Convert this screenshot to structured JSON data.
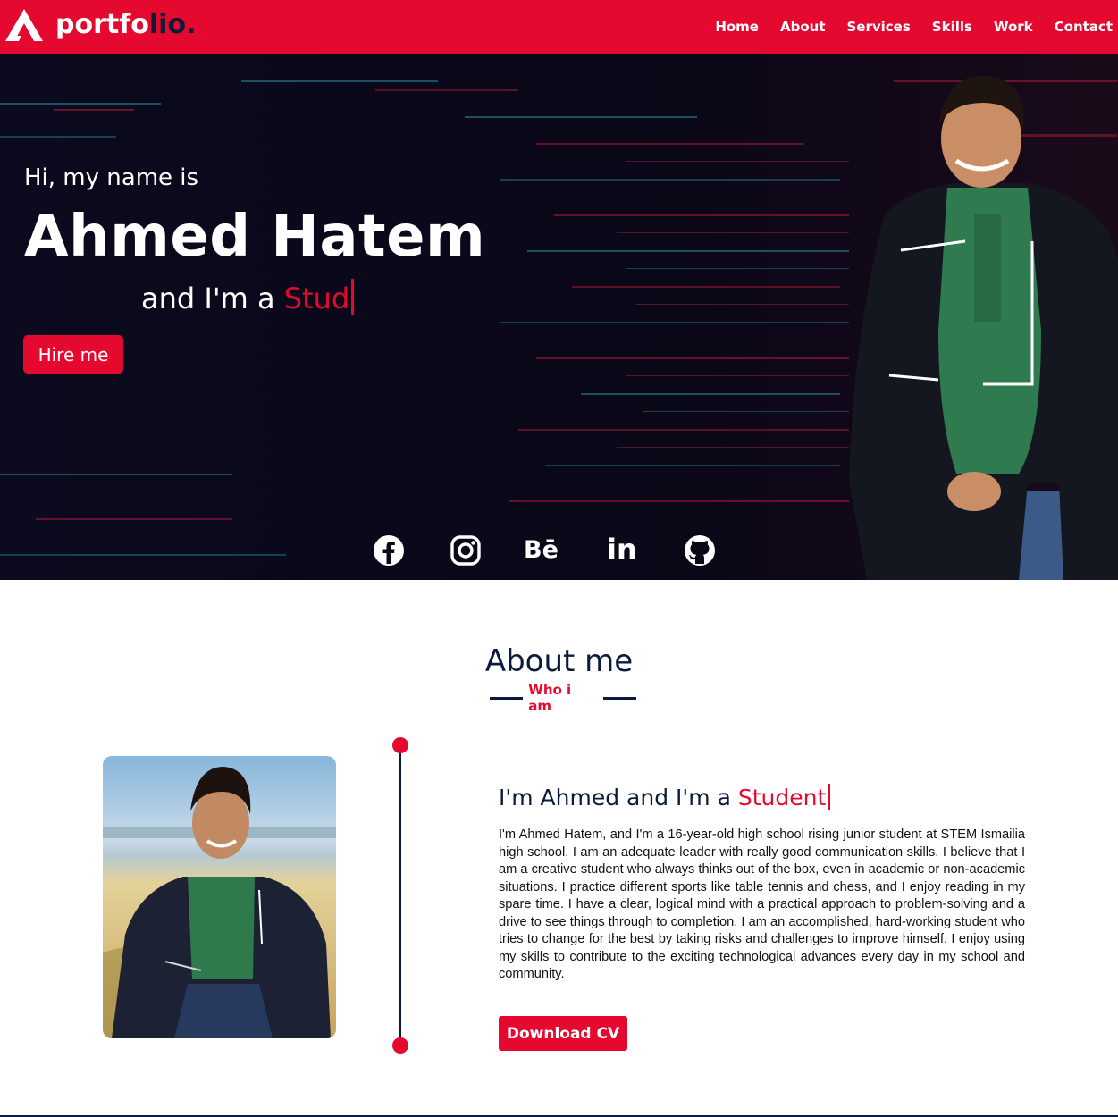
{
  "brand": {
    "logo_main": "portfo",
    "logo_accent": "lio."
  },
  "nav": {
    "items": [
      {
        "label": "Home"
      },
      {
        "label": "About"
      },
      {
        "label": "Services"
      },
      {
        "label": "Skills"
      },
      {
        "label": "Work"
      },
      {
        "label": "Contact"
      }
    ]
  },
  "hero": {
    "greeting": "Hi, my name is",
    "name": "Ahmed Hatem",
    "role_prefix": "and I'm a ",
    "role_typed": "Stud",
    "hire_label": "Hire me"
  },
  "socials": [
    {
      "icon": "facebook-icon"
    },
    {
      "icon": "instagram-icon"
    },
    {
      "icon": "behance-icon",
      "glyph": "Bē"
    },
    {
      "icon": "linkedin-icon",
      "glyph": "in"
    },
    {
      "icon": "github-icon"
    }
  ],
  "about": {
    "title": "About me",
    "subtitle": "Who i am",
    "heading_prefix": "I'm Ahmed and I'm a ",
    "heading_typed": "Student",
    "paragraph": "I'm Ahmed Hatem, and I'm a 16-year-old high school rising junior student at STEM Ismailia high school. I am an adequate leader with really good communication skills. I believe that I am a creative student who always thinks out of the box, even in academic or non-academic situations. I practice different sports like table tennis and chess, and I enjoy reading in my spare time. I have a clear, logical mind with a practical approach to problem-solving and a drive to see things through to completion. I am an accomplished, hard-working student who tries to change for the best by taking risks and challenges to improve himself. I enjoy using my skills to contribute to the exciting technological advances every day in my school and community.",
    "cv_label": "Download CV"
  },
  "colors": {
    "accent": "#e6092f",
    "navy": "#0b1b3a",
    "hero_bg": "#0a0717"
  }
}
